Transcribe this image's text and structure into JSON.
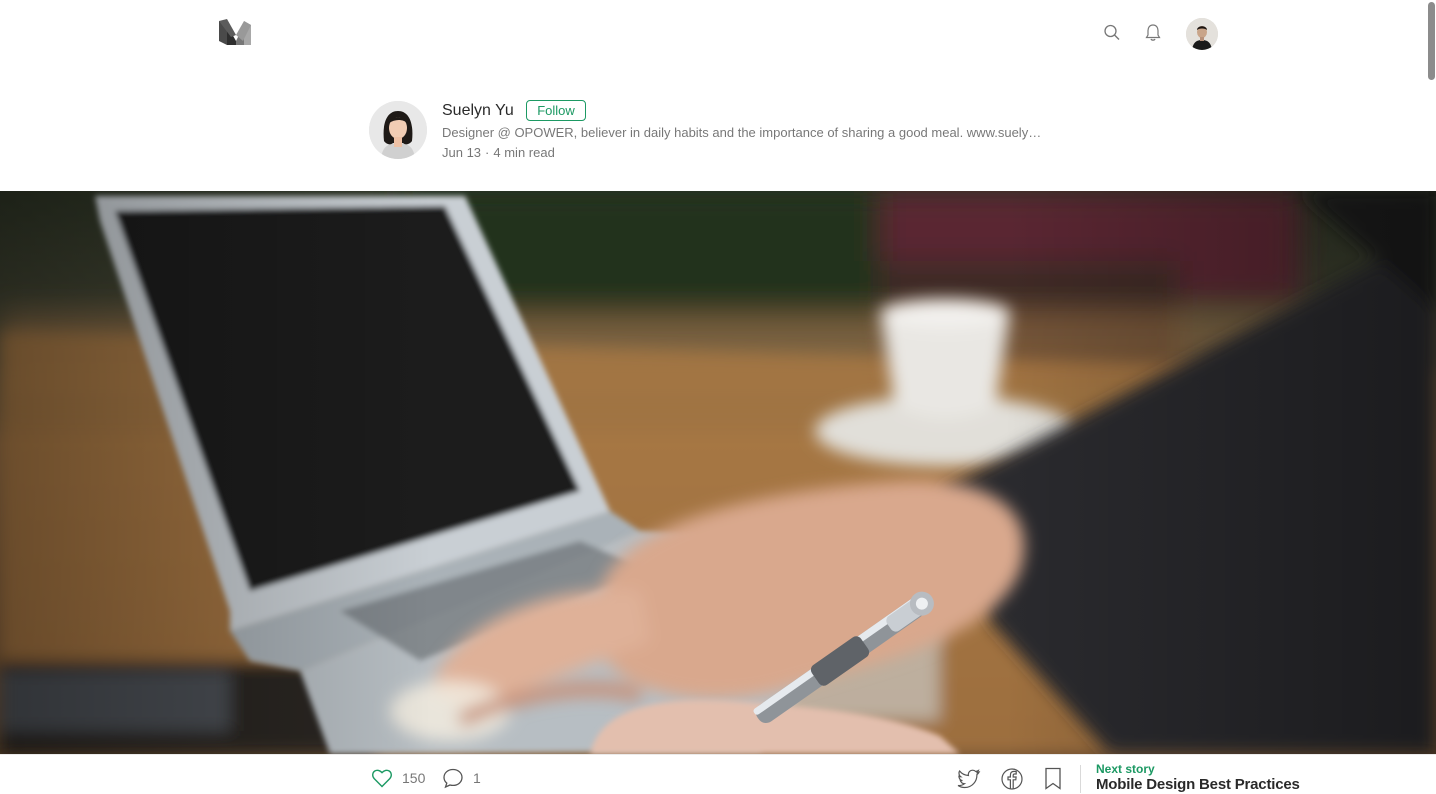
{
  "nav": {
    "logo_icon": "medium-logo-icon",
    "search_icon": "search-icon",
    "notifications_icon": "bell-icon",
    "user_avatar": "user-avatar"
  },
  "author": {
    "name": "Suelyn Yu",
    "follow_label": "Follow",
    "bio": "Designer @ OPOWER, believer in daily habits and the importance of sharing a good meal. www.suely…",
    "date": "Jun 13",
    "separator": "·",
    "read_time": "4 min read"
  },
  "footer": {
    "clap_count": "150",
    "response_count": "1",
    "next_label": "Next story",
    "next_title": "Mobile Design Best Practices"
  },
  "colors": {
    "accent": "#1c9963",
    "text": "#000000",
    "muted": "#8a8a8a"
  }
}
